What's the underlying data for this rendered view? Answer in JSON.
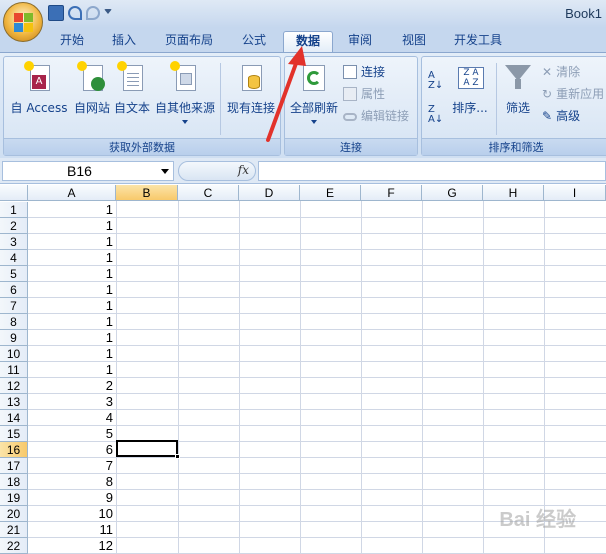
{
  "window": {
    "title": "Book1"
  },
  "tabs": [
    "开始",
    "插入",
    "页面布局",
    "公式",
    "数据",
    "审阅",
    "视图",
    "开发工具"
  ],
  "active_tab": "数据",
  "ribbon": {
    "external_group": {
      "label": "获取外部数据",
      "buttons": [
        "自 Access",
        "自网站",
        "自文本",
        "自其他来源",
        "现有连接"
      ]
    },
    "connections_group": {
      "label": "连接",
      "refresh_all": "全部刷新",
      "connections": "连接",
      "properties": "属性",
      "edit_links": "编辑链接"
    },
    "sort_filter_group": {
      "label": "排序和筛选",
      "sort": "排序...",
      "filter": "筛选",
      "clear": "清除",
      "reapply": "重新应用",
      "advanced": "高级"
    }
  },
  "formula_bar": {
    "name_box": "B16",
    "fx": "fx",
    "formula": ""
  },
  "grid": {
    "columns": [
      "A",
      "B",
      "C",
      "D",
      "E",
      "F",
      "G",
      "H",
      "I"
    ],
    "selected_column": "B",
    "selected_row": "16",
    "rows": [
      {
        "num": "1",
        "a": "1"
      },
      {
        "num": "2",
        "a": "1"
      },
      {
        "num": "3",
        "a": "1"
      },
      {
        "num": "4",
        "a": "1"
      },
      {
        "num": "5",
        "a": "1"
      },
      {
        "num": "6",
        "a": "1"
      },
      {
        "num": "7",
        "a": "1"
      },
      {
        "num": "8",
        "a": "1"
      },
      {
        "num": "9",
        "a": "1"
      },
      {
        "num": "10",
        "a": "1"
      },
      {
        "num": "11",
        "a": "1"
      },
      {
        "num": "12",
        "a": "2"
      },
      {
        "num": "13",
        "a": "3"
      },
      {
        "num": "14",
        "a": "4"
      },
      {
        "num": "15",
        "a": "5"
      },
      {
        "num": "16",
        "a": "6"
      },
      {
        "num": "17",
        "a": "7"
      },
      {
        "num": "18",
        "a": "8"
      },
      {
        "num": "19",
        "a": "9"
      },
      {
        "num": "20",
        "a": "10"
      },
      {
        "num": "21",
        "a": "11"
      },
      {
        "num": "22",
        "a": "12"
      }
    ]
  },
  "watermark": "Bai 经验"
}
